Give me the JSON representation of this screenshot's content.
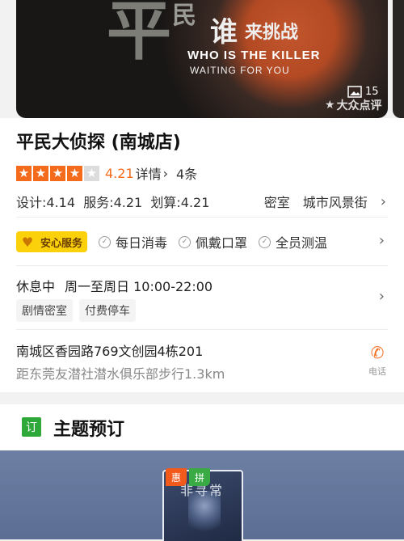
{
  "hero": {
    "big_char": "平",
    "small_char": "民",
    "title_char": "谁",
    "title_rest": "来挑战",
    "line1": "WHO IS THE KILLER",
    "line2": "WAITING FOR YOU",
    "photo_count": "15",
    "watermark": "大众点评",
    "photo_icon": "image-icon",
    "watermark_icon": "dianping-logo-icon"
  },
  "shop": {
    "name": "平民大侦探 (南城店)",
    "rating_stars": 4,
    "rating_max": 5,
    "score": "4.21",
    "detail_label": "详情",
    "detail_arrow": "›",
    "review_count": "4条",
    "sub_scores": "设计:4.14  服务:4.21  划算:4.21",
    "category": "密室",
    "area": "城市风景街"
  },
  "service": {
    "badge": "安心服务",
    "items": [
      "每日消毒",
      "佩戴口罩",
      "全员测温"
    ]
  },
  "hours": {
    "status": "休息中",
    "time": "周一至周日 10:00-22:00",
    "tags": [
      "剧情密室",
      "付费停车"
    ]
  },
  "address": {
    "line": "南城区香园路769文创园4栋201",
    "distance": "距东莞友潜社潜水俱乐部步行1.3km",
    "phone_label": "电话"
  },
  "section": {
    "icon_text": "订",
    "title": "主题预订"
  },
  "product": {
    "badge_discount": "惠",
    "badge_group": "拼",
    "poster_title": "非寻常"
  },
  "colors": {
    "accent_orange": "#f56b1c",
    "service_yellow": "#fbd10c",
    "section_green": "#2fa83a"
  }
}
